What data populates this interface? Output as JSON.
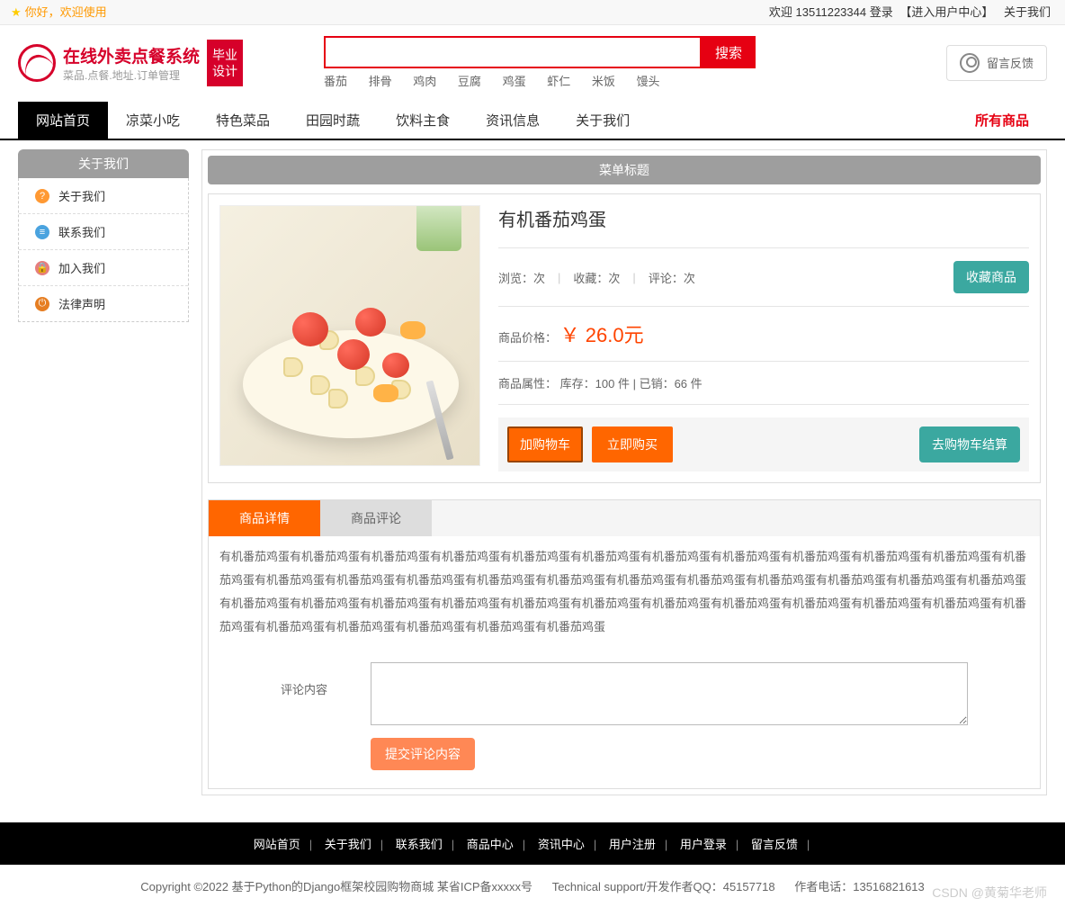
{
  "topbar": {
    "welcome": "你好，欢迎使用",
    "welcome_user": "欢迎 13511223344 登录",
    "user_center": "【进入用户中心】",
    "about": "关于我们"
  },
  "logo": {
    "title": "在线外卖点餐系统",
    "subtitle": "菜品.点餐.地址.订单管理",
    "badge_l1": "毕业",
    "badge_l2": "设计"
  },
  "search": {
    "button": "搜索",
    "hotwords": [
      "番茄",
      "排骨",
      "鸡肉",
      "豆腐",
      "鸡蛋",
      "虾仁",
      "米饭",
      "馒头"
    ]
  },
  "feedback": {
    "label": "留言反馈"
  },
  "nav": {
    "items": [
      "网站首页",
      "凉菜小吃",
      "特色菜品",
      "田园时蔬",
      "饮料主食",
      "资讯信息",
      "关于我们"
    ],
    "active_index": 0,
    "all_products": "所有商品"
  },
  "sidebar": {
    "title": "关于我们",
    "items": [
      {
        "icon": "orange",
        "glyph": "?",
        "label": "关于我们"
      },
      {
        "icon": "blue",
        "glyph": "≡",
        "label": "联系我们"
      },
      {
        "icon": "red",
        "glyph": "🔒",
        "label": "加入我们"
      },
      {
        "icon": "oran2",
        "glyph": "⏻",
        "label": "法律声明"
      }
    ]
  },
  "content": {
    "title_bar": "菜单标题",
    "product": {
      "name": "有机番茄鸡蛋",
      "views_label": "浏览：次",
      "favs_label": "收藏：次",
      "comments_label": "评论：次",
      "fav_btn": "收藏商品",
      "price_label": "商品价格：",
      "price": "￥ 26.0元",
      "attr_label": "商品属性：",
      "stock": "库存：100 件",
      "sold": "已销：66 件",
      "add_cart": "加购物车",
      "buy_now": "立即购买",
      "go_cart": "去购物车结算"
    },
    "tabs": {
      "detail": "商品详情",
      "comments": "商品评论"
    },
    "description": "有机番茄鸡蛋有机番茄鸡蛋有机番茄鸡蛋有机番茄鸡蛋有机番茄鸡蛋有机番茄鸡蛋有机番茄鸡蛋有机番茄鸡蛋有机番茄鸡蛋有机番茄鸡蛋有机番茄鸡蛋有机番茄鸡蛋有机番茄鸡蛋有机番茄鸡蛋有机番茄鸡蛋有机番茄鸡蛋有机番茄鸡蛋有机番茄鸡蛋有机番茄鸡蛋有机番茄鸡蛋有机番茄鸡蛋有机番茄鸡蛋有机番茄鸡蛋有机番茄鸡蛋有机番茄鸡蛋有机番茄鸡蛋有机番茄鸡蛋有机番茄鸡蛋有机番茄鸡蛋有机番茄鸡蛋有机番茄鸡蛋有机番茄鸡蛋有机番茄鸡蛋有机番茄鸡蛋有机番茄鸡蛋有机番茄鸡蛋有机番茄鸡蛋有机番茄鸡蛋有机番茄鸡蛋有机番茄鸡蛋",
    "comment_label": "评论内容",
    "submit_btn": "提交评论内容"
  },
  "footer": {
    "links": [
      "网站首页",
      "关于我们",
      "联系我们",
      "商品中心",
      "资讯中心",
      "用户注册",
      "用户登录",
      "留言反馈"
    ],
    "copyright": "Copyright ©2022 基于Python的Django框架校园购物商城 某省ICP备xxxxx号",
    "support": "Technical support/开发作者QQ：45157718",
    "phone": "作者电话：13516821613",
    "watermark": "CSDN @黄菊华老师"
  }
}
